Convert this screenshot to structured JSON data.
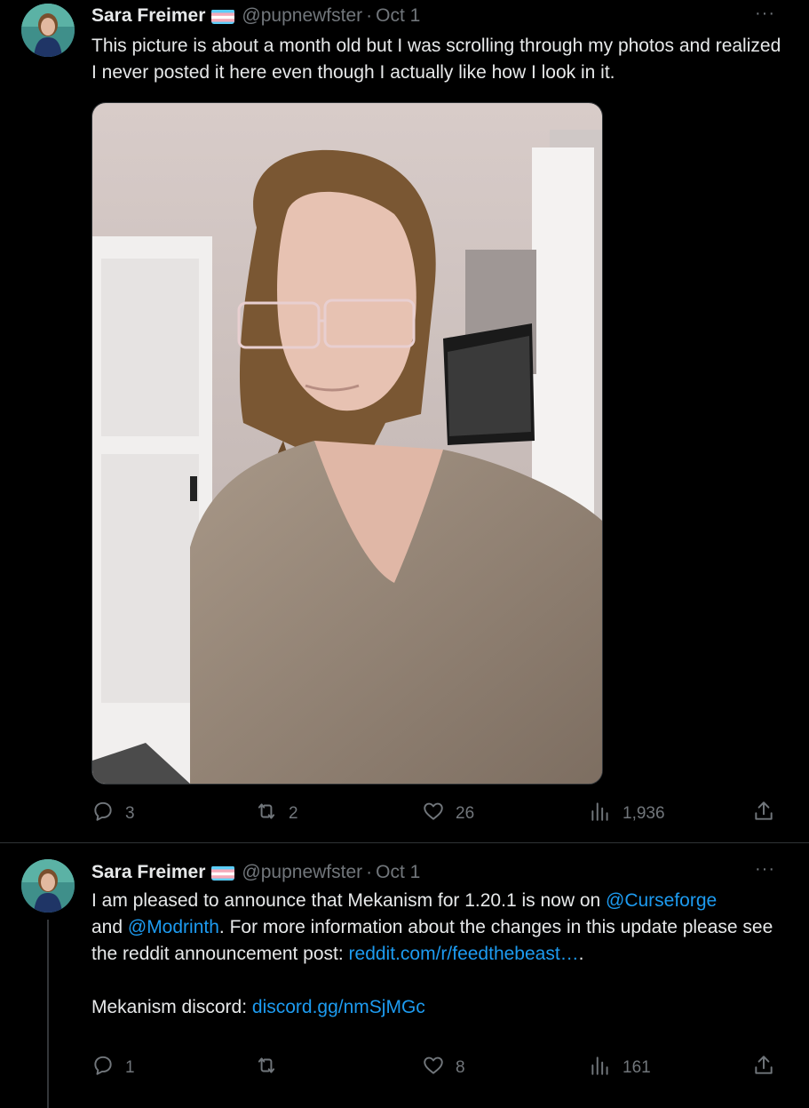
{
  "colors": {
    "background": "#000000",
    "text": "#e7e9ea",
    "muted": "#71767b",
    "link": "#1d9bf0",
    "divider": "#2f3336"
  },
  "tweets": [
    {
      "author": "Sara Freimer",
      "handle": "@pupnewfster",
      "separator": "·",
      "date": "Oct 1",
      "more": "···",
      "text": "This picture is about a month old but I was scrolling through my photos and realized I never posted it here even though I actually like how I look in it.",
      "icons": {
        "avatar": "avatar",
        "flag": "transgender-flag-icon",
        "more": "more-icon"
      },
      "stats": {
        "replies": "3",
        "retweets": "2",
        "likes": "26",
        "views": "1,936"
      }
    },
    {
      "author": "Sara Freimer",
      "handle": "@pupnewfster",
      "separator": "·",
      "date": "Oct 1",
      "more": "···",
      "text_parts": {
        "p1": "I am pleased to announce that Mekanism for 1.20.1 is now on ",
        "link_curseforge": "@Curseforge",
        "p2": " and ",
        "link_modrinth": "@Modrinth",
        "p3": ". For more information about the changes in this update please see the reddit announcement post: ",
        "link_reddit": "reddit.com/r/feedthebeast…",
        "p4": ".",
        "discord_label": "Mekanism discord: ",
        "link_discord": "discord.gg/nmSjMGc"
      },
      "stats": {
        "replies": "1",
        "retweets": "",
        "likes": "8",
        "views": "161"
      }
    }
  ]
}
